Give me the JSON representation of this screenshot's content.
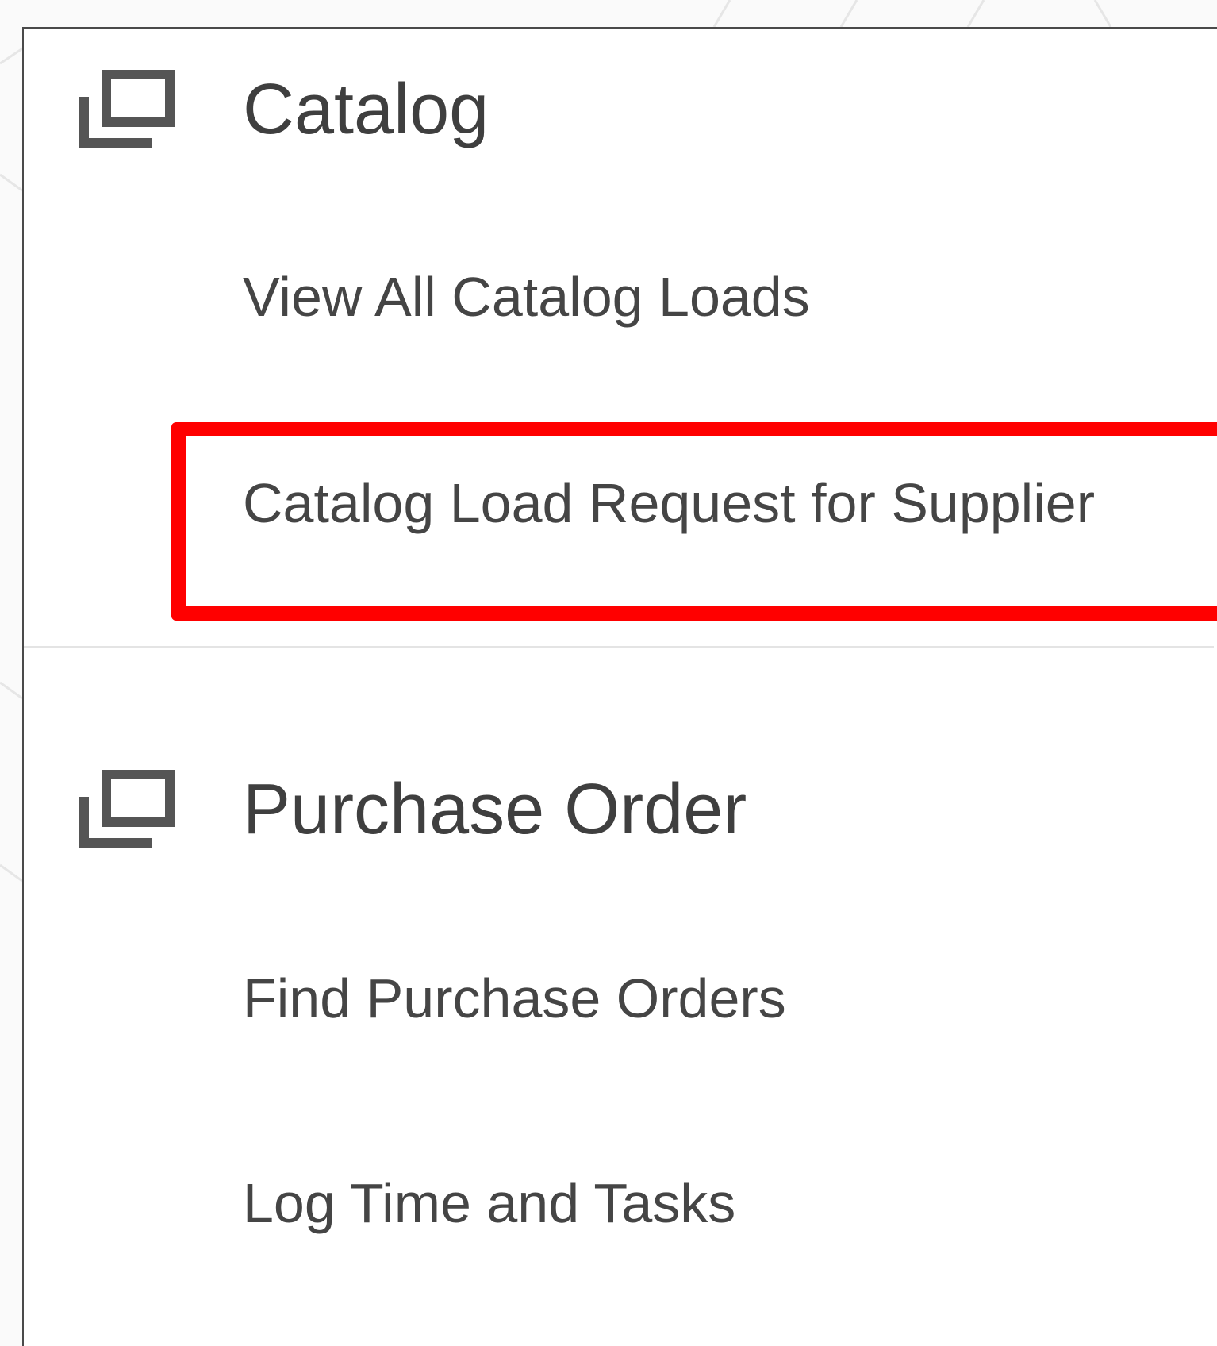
{
  "sections": [
    {
      "title": "Catalog",
      "icon": "collection-icon",
      "items": [
        {
          "label": "View All Catalog Loads"
        },
        {
          "label": "Catalog Load Request for Supplier"
        }
      ]
    },
    {
      "title": "Purchase Order",
      "icon": "collection-icon",
      "items": [
        {
          "label": "Find Purchase Orders"
        },
        {
          "label": "Log Time and Tasks"
        }
      ]
    }
  ],
  "highlight": {
    "target": "Catalog Load Request for Supplier",
    "color": "#ff0000"
  },
  "colors": {
    "text": "#454545",
    "icon": "#555555",
    "divider": "#e4e4e4"
  }
}
